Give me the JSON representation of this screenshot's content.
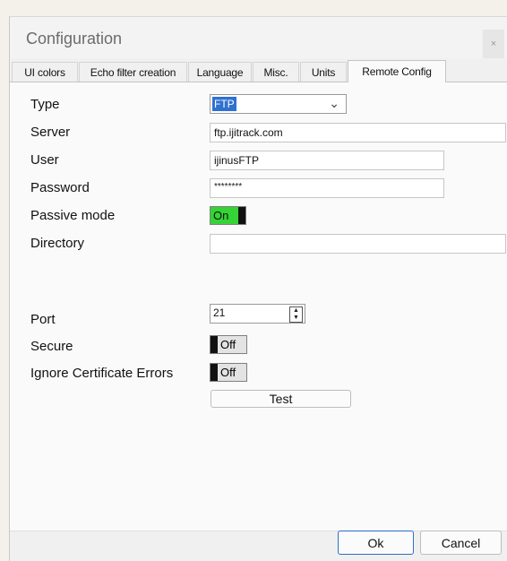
{
  "window": {
    "title": "Configuration",
    "close_label": "×"
  },
  "tabs": [
    {
      "label": "UI colors"
    },
    {
      "label": "Echo filter creation"
    },
    {
      "label": "Language"
    },
    {
      "label": "Misc."
    },
    {
      "label": "Units"
    },
    {
      "label": "Remote Config",
      "active": true
    }
  ],
  "form": {
    "type": {
      "label": "Type",
      "value": "FTP"
    },
    "server": {
      "label": "Server",
      "value": "ftp.ijitrack.com"
    },
    "user": {
      "label": "User",
      "value": "ijinusFTP"
    },
    "password": {
      "label": "Password",
      "value": "********"
    },
    "passive_mode": {
      "label": "Passive mode",
      "value": "On",
      "color": "#35d335"
    },
    "directory": {
      "label": "Directory",
      "value": ""
    },
    "port": {
      "label": "Port",
      "value": "21"
    },
    "secure": {
      "label": "Secure",
      "value": "Off"
    },
    "ignore_cert_errors": {
      "label": "Ignore Certificate Errors",
      "value": "Off"
    }
  },
  "buttons": {
    "test": "Test",
    "ok": "Ok",
    "cancel": "Cancel"
  },
  "icons": {
    "dropdown": "chevron-down-icon",
    "spin": "spin-arrows-icon",
    "close": "close-icon"
  },
  "colors": {
    "selection": "#2f71cf",
    "accent_border": "#2a6fcb"
  }
}
